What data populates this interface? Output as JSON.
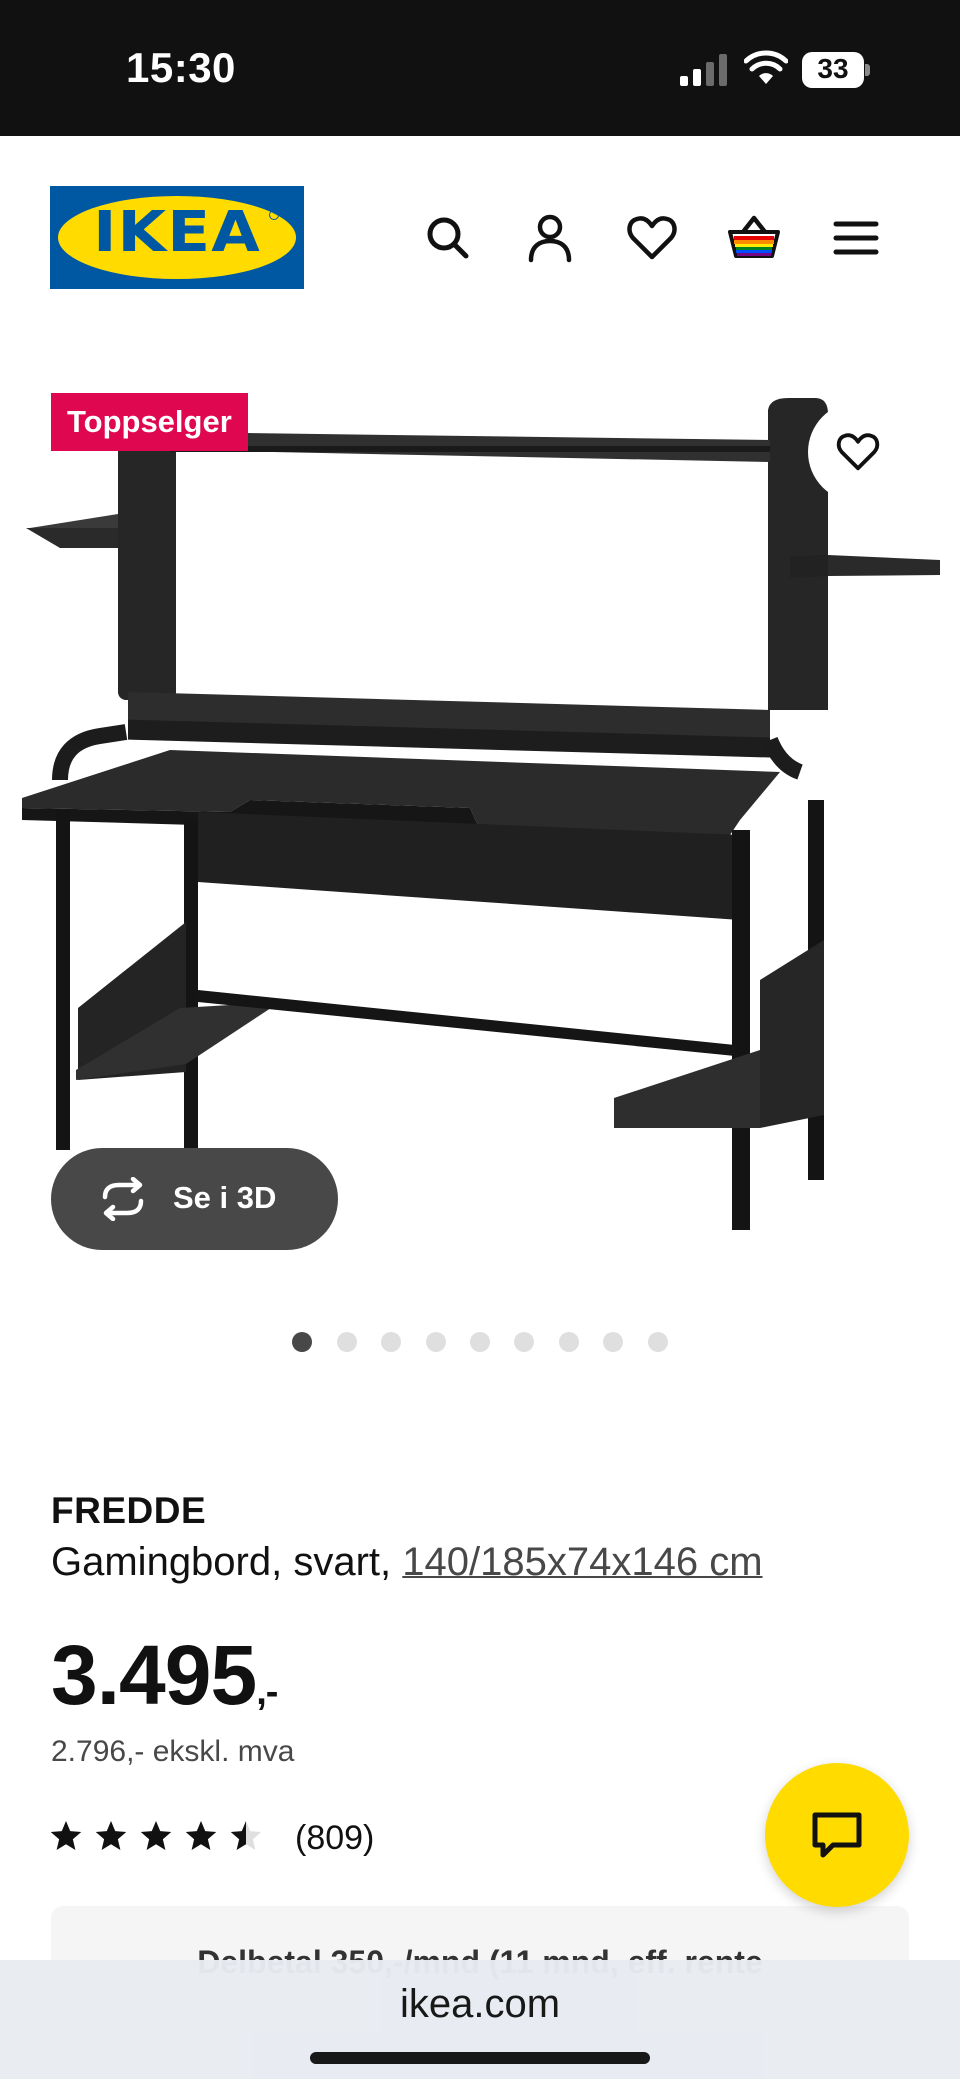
{
  "status_bar": {
    "time": "15:30",
    "battery": "33"
  },
  "header": {
    "logo_text": "IKEA",
    "icons": [
      "search-icon",
      "user-icon",
      "heart-icon",
      "basket-icon",
      "menu-icon"
    ]
  },
  "product_image": {
    "badge": "Toppselger",
    "view_3d_label": "Se i 3D",
    "image_count": 9,
    "active_image_index": 0
  },
  "product": {
    "name": "FREDDE",
    "description": "Gamingbord, svart,",
    "measurements": "140/185x74x146 cm",
    "price_main": "3.495",
    "price_suffix": ",-",
    "price_excl_vat": "2.796,- ekskl. mva",
    "rating_value": 4.5,
    "rating_max": 5,
    "review_count": "(809)"
  },
  "payment": {
    "text": "Delbetal 350,-/mnd (11 mnd, eff. rente"
  },
  "browser": {
    "url": "ikea.com"
  },
  "colors": {
    "ikea_blue": "#0058a3",
    "ikea_yellow": "#ffdb00",
    "badge_red": "#e00751",
    "dark_gray": "#484848"
  }
}
